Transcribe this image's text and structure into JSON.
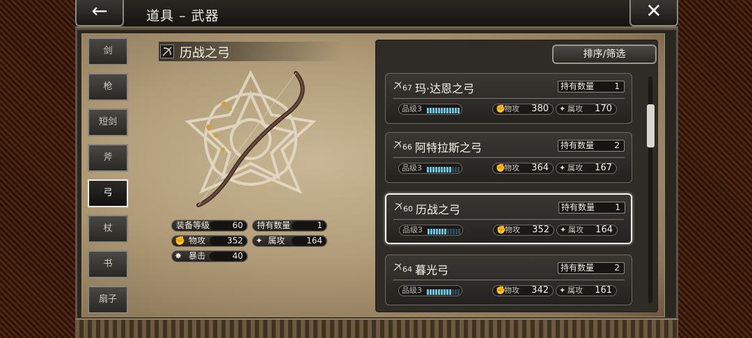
{
  "header": {
    "title": "道具 – 武器",
    "back_icon": "←",
    "close_icon": "✕"
  },
  "categories": [
    {
      "label": "剑"
    },
    {
      "label": "枪"
    },
    {
      "label": "短剑"
    },
    {
      "label": "斧"
    },
    {
      "label": "弓"
    },
    {
      "label": "杖"
    },
    {
      "label": "书"
    },
    {
      "label": "扇子"
    }
  ],
  "active_category": "弓",
  "detail": {
    "name": "历战之弓",
    "equip_level_label": "装备等级",
    "equip_level": "60",
    "owned_label": "持有数量",
    "owned": "1",
    "phys_label": "物攻",
    "phys": "352",
    "elem_label": "属攻",
    "elem": "164",
    "crit_label": "暴击",
    "crit": "40"
  },
  "list": {
    "sort_label": "排序/筛选",
    "items": [
      {
        "level": "67",
        "name": "玛·达恩之弓",
        "owned_label": "持有数量",
        "owned": "1",
        "grade_label": "品级3",
        "grade_fill": 1.0,
        "phys_label": "物攻",
        "phys": "380",
        "elem_label": "属攻",
        "elem": "170"
      },
      {
        "level": "66",
        "name": "阿特拉斯之弓",
        "owned_label": "持有数量",
        "owned": "2",
        "grade_label": "品级3",
        "grade_fill": 0.75,
        "phys_label": "物攻",
        "phys": "364",
        "elem_label": "属攻",
        "elem": "167"
      },
      {
        "level": "60",
        "name": "历战之弓",
        "owned_label": "持有数量",
        "owned": "1",
        "grade_label": "品级3",
        "grade_fill": 0.58,
        "phys_label": "物攻",
        "phys": "352",
        "elem_label": "属攻",
        "elem": "164",
        "selected": true
      },
      {
        "level": "64",
        "name": "暮光弓",
        "owned_label": "持有数量",
        "owned": "2",
        "grade_label": "品级3",
        "grade_fill": 0.75,
        "phys_label": "物攻",
        "phys": "342",
        "elem_label": "属攻",
        "elem": "161"
      }
    ]
  },
  "colors": {
    "accent_bar": "#67c6de",
    "selected_border": "#f5f3ee"
  }
}
